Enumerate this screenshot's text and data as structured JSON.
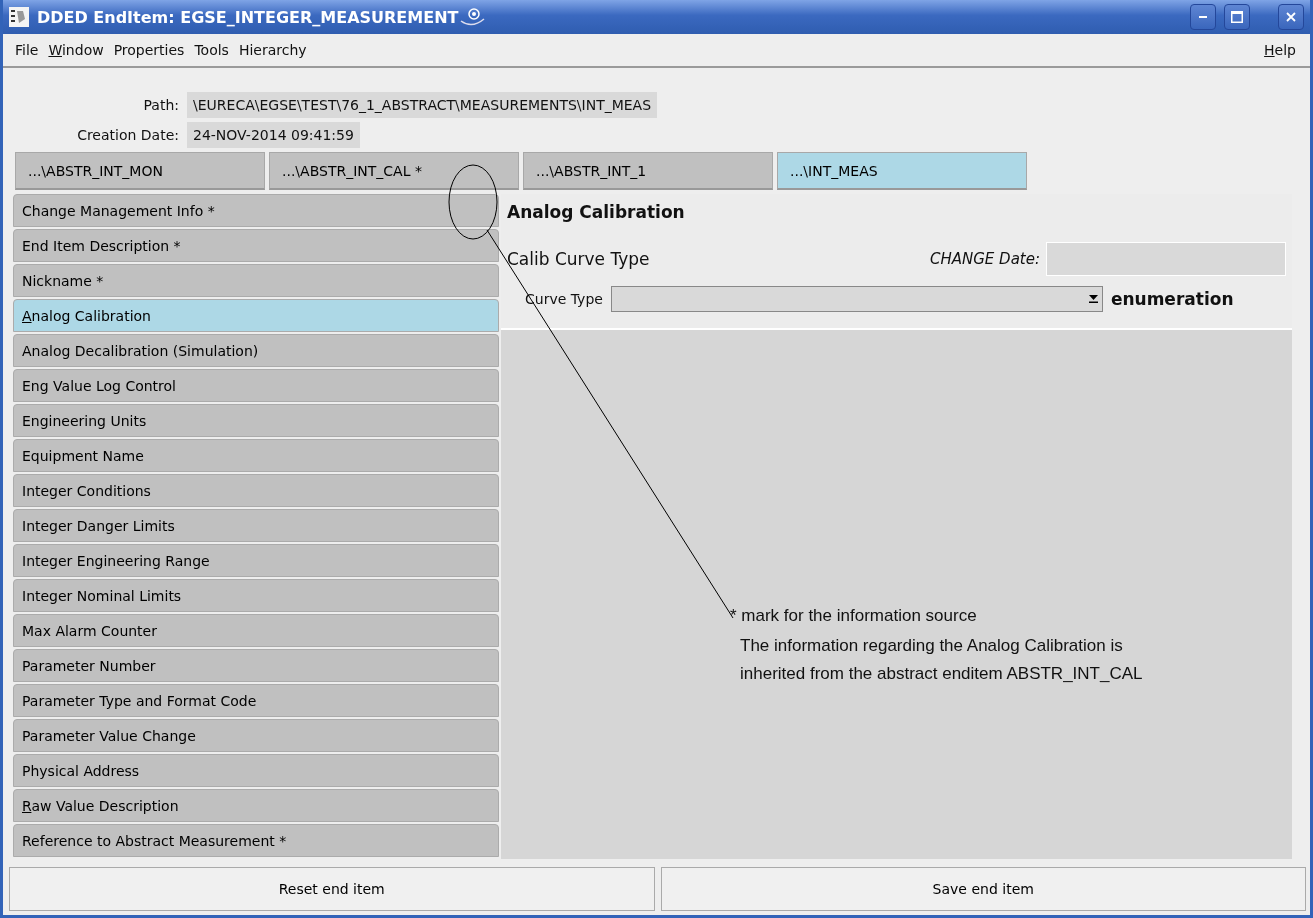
{
  "window": {
    "title": "DDED EndItem: EGSE_INTEGER_MEASUREMENT"
  },
  "menu": [
    {
      "label": "File",
      "underline_first": false
    },
    {
      "label": "Window",
      "underline_first": true
    },
    {
      "label": "Properties",
      "underline_first": false
    },
    {
      "label": "Tools",
      "underline_first": false
    },
    {
      "label": "Hierarchy",
      "underline_first": false
    }
  ],
  "help_menu": {
    "label": "Help",
    "underline_first": true
  },
  "fields": [
    {
      "label": "Path:",
      "value": "\\EURECA\\EGSE\\TEST\\76_1_ABSTRACT\\MEASUREMENTS\\INT_MEAS"
    },
    {
      "label": "Creation Date:",
      "value": "24-NOV-2014 09:41:59"
    }
  ],
  "tabs": [
    {
      "label": "...\\ABSTR_INT_MON",
      "selected": false
    },
    {
      "label": "...\\ABSTR_INT_CAL *",
      "selected": false
    },
    {
      "label": "...\\ABSTR_INT_1",
      "selected": false
    },
    {
      "label": "...\\INT_MEAS",
      "selected": true
    }
  ],
  "sidebar": {
    "items": [
      {
        "label": "Change Management Info *",
        "selected": false,
        "underline_first": false
      },
      {
        "label": "End Item Description *",
        "selected": false,
        "underline_first": false
      },
      {
        "label": "Nickname *",
        "selected": false,
        "underline_first": false
      },
      {
        "label": "Analog Calibration",
        "selected": true,
        "underline_first": true
      },
      {
        "label": "Analog Decalibration (Simulation)",
        "selected": false,
        "underline_first": false
      },
      {
        "label": "Eng Value Log Control",
        "selected": false,
        "underline_first": false
      },
      {
        "label": "Engineering Units",
        "selected": false,
        "underline_first": false
      },
      {
        "label": "Equipment Name",
        "selected": false,
        "underline_first": false
      },
      {
        "label": "Integer Conditions",
        "selected": false,
        "underline_first": false
      },
      {
        "label": "Integer Danger Limits",
        "selected": false,
        "underline_first": false
      },
      {
        "label": "Integer Engineering Range",
        "selected": false,
        "underline_first": false
      },
      {
        "label": "Integer Nominal Limits",
        "selected": false,
        "underline_first": false
      },
      {
        "label": "Max Alarm Counter",
        "selected": false,
        "underline_first": false
      },
      {
        "label": "Parameter Number",
        "selected": false,
        "underline_first": false
      },
      {
        "label": "Parameter Type and Format Code",
        "selected": false,
        "underline_first": false
      },
      {
        "label": "Parameter Value Change",
        "selected": false,
        "underline_first": false
      },
      {
        "label": "Physical Address",
        "selected": false,
        "underline_first": false
      },
      {
        "label": "Raw Value Description",
        "selected": false,
        "underline_first": true
      },
      {
        "label": "Reference to Abstract Measurement *",
        "selected": false,
        "underline_first": false
      }
    ]
  },
  "panel": {
    "title": "Analog Calibration",
    "section": "Calib Curve Type",
    "change_date_label": "CHANGE Date:",
    "field_label": "Curve Type",
    "type_label": "enumeration"
  },
  "annotation": {
    "note": "* mark for the information source",
    "explanation": [
      "The information regarding the Analog Calibration is",
      "inherited from the abstract enditem ABSTR_INT_CAL"
    ]
  },
  "buttons": [
    "Reset end item",
    "Save end item"
  ]
}
